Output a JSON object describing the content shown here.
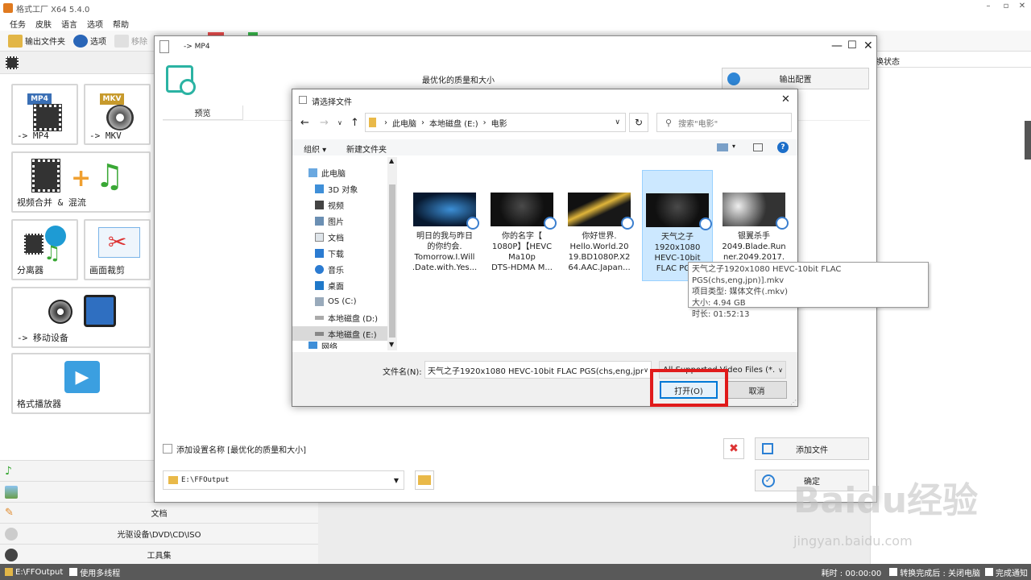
{
  "app": {
    "title": "格式工厂 X64 5.4.0"
  },
  "menu": [
    "任务",
    "皮肤",
    "语言",
    "选项",
    "帮助"
  ],
  "toolbar": {
    "output_folder": "输出文件夹",
    "options": "选项",
    "remove": "移除"
  },
  "right_panel": {
    "header": "转换状态",
    "header_visible": "换状态"
  },
  "tiles": [
    {
      "label": "-> MP4",
      "badge": "MP4"
    },
    {
      "label": "-> MKV",
      "badge": "MKV"
    },
    {
      "label": "视频合并 & 混流"
    },
    {
      "label": "分离器"
    },
    {
      "label": "画面裁剪"
    },
    {
      "label": "-> 移动设备"
    },
    {
      "label": "格式播放器"
    }
  ],
  "categories": {
    "doc": "文档",
    "disc": "光驱设备\\DVD\\CD\\ISO",
    "tools": "工具集"
  },
  "status": {
    "path": "E:\\FFOutput",
    "multithread": "使用多线程",
    "elapsed": "耗时 : 00:00:00",
    "after": "转换完成后 : 关闭电脑",
    "notify": "完成通知"
  },
  "mp4": {
    "title": "-> MP4",
    "quality": "最优化的质量和大小",
    "output_config": "输出配置",
    "preview": "预览",
    "add_setting_name": "添加设置名称 [最优化的质量和大小]",
    "add_file": "添加文件",
    "output_path": "E:\\FFOutput",
    "ok": "确定"
  },
  "file_dialog": {
    "title": "请选择文件",
    "breadcrumb": [
      "此电脑",
      "本地磁盘 (E:)",
      "电影"
    ],
    "search_placeholder": "搜索\"电影\"",
    "organize": "组织",
    "new_folder": "新建文件夹",
    "tree": [
      "此电脑",
      "3D 对象",
      "视频",
      "图片",
      "文档",
      "下载",
      "音乐",
      "桌面",
      "OS (C:)",
      "本地磁盘 (D:)",
      "本地磁盘 (E:)",
      "网络"
    ],
    "files": [
      {
        "lines": [
          "明日的我与昨日",
          "的你约会.",
          "Tomorrow.I.Will",
          ".Date.with.Yes..."
        ]
      },
      {
        "lines": [
          "你的名字【",
          "1080P】【HEVC",
          "Ma10p",
          "DTS-HDMA M..."
        ]
      },
      {
        "lines": [
          "你好世界.",
          "Hello.World.20",
          "19.BD1080P.X2",
          "64.AAC.Japan..."
        ]
      },
      {
        "lines": [
          "天气之子",
          "1920x1080",
          "HEVC-10bit",
          "FLAC PGS("
        ]
      },
      {
        "lines": [
          "银翼杀手",
          "2049.Blade.Run",
          "ner.2049.2017."
        ]
      }
    ],
    "tooltip": {
      "name": "天气之子1920x1080 HEVC-10bit FLAC PGS(chs,eng,jpn)].mkv",
      "type": "项目类型: 媒体文件(.mkv)",
      "size": "大小: 4.94 GB",
      "duration": "时长: 01:52:13"
    },
    "filename_label": "文件名(N):",
    "filename_value": "天气之子1920x1080 HEVC-10bit FLAC PGS(chs,eng,jpn)",
    "filter": "All Supported Video Files (*.",
    "open": "打开(O)",
    "cancel": "取消"
  },
  "watermark": {
    "brand": "Baidu经验",
    "url": "jingyan.baidu.com"
  },
  "colors": {
    "accent": "#2bb3a3",
    "highlight": "#e01a1a",
    "selected": "#cce8ff",
    "link": "#3b7fcf"
  }
}
